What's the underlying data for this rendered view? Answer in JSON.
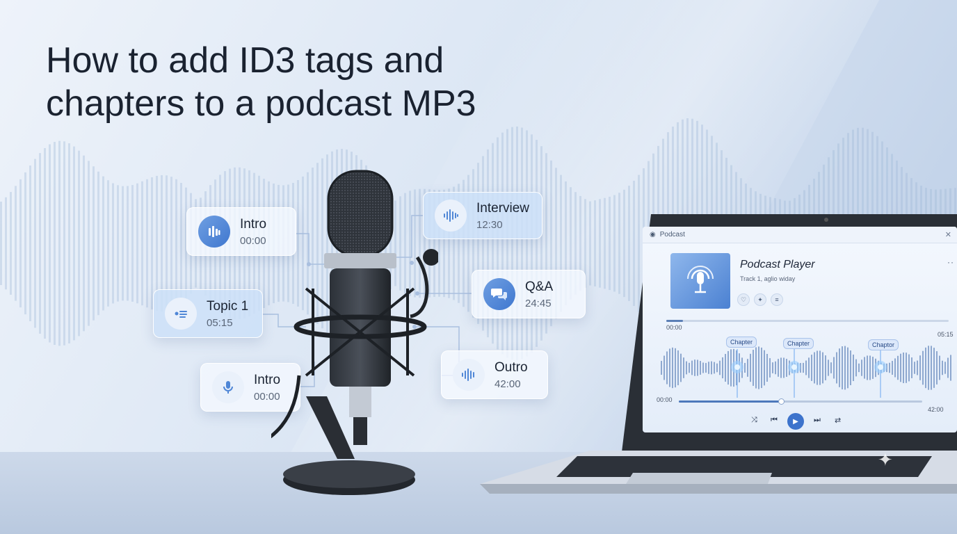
{
  "headline": {
    "line1": "How to add ID3 tags and",
    "line2": "chapters to a podcast MP3"
  },
  "chapter_cards": [
    {
      "title": "Intro",
      "time": "00:00",
      "icon": "equalizer-bars-icon"
    },
    {
      "title": "Topic 1",
      "time": "05:15",
      "icon": "list-icon"
    },
    {
      "title": "Intro",
      "time": "00:00",
      "icon": "microphone-icon"
    },
    {
      "title": "Interview",
      "time": "12:30",
      "icon": "waveform-icon"
    },
    {
      "title": "Q&A",
      "time": "24:45",
      "icon": "chat-bubbles-icon"
    },
    {
      "title": "Outro",
      "time": "42:00",
      "icon": "waveform-icon"
    }
  ],
  "player": {
    "window_title": "Podcast",
    "title": "Podcast Player",
    "subtitle": "Track 1, aglio widay",
    "more_label": "··",
    "close_label": "✕",
    "time_start_top": "00:00",
    "time_end_top": "05:15",
    "time_start_bottom": "00:00",
    "time_end_bottom": "42:00",
    "chapter_tags": [
      "Chapter",
      "Chapter",
      "Chaptor"
    ],
    "top_progress": 0.06,
    "bottom_progress": 0.42
  },
  "colors": {
    "accent": "#3d73cc",
    "card_icon": "#4f86d6",
    "headline": "#1a2230"
  }
}
